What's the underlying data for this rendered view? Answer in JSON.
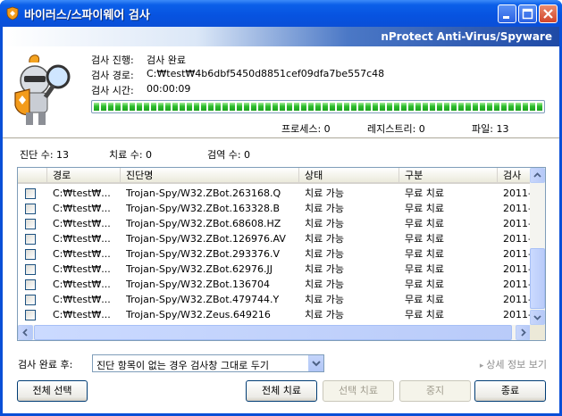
{
  "window": {
    "title": "바이러스/스파이웨어 검사",
    "brand": "nProtect Anti-Virus/Spyware"
  },
  "scan_info": {
    "progress_label": "검사 진행:",
    "progress_value": "검사 완료",
    "path_label": "검사 경로:",
    "path_value": "C:₩test₩4b6dbf5450d8851cef09dfa7be557c48",
    "time_label": "검사 시간:",
    "time_value": "00:00:09",
    "progress_fraction": 1.0
  },
  "counts": {
    "process": "프로세스: 0",
    "registry": "레지스트리: 0",
    "file": "파일: 13"
  },
  "summary": {
    "diagnosed": "진단 수: 13",
    "treated": "치료 수: 0",
    "quarantined": "검역 수: 0"
  },
  "table": {
    "columns": [
      "경로",
      "진단명",
      "상태",
      "구분",
      "검사"
    ],
    "rows": [
      {
        "path": "C:₩test₩...",
        "name": "Trojan-Spy/W32.ZBot.263168.Q",
        "status": "치료 가능",
        "type": "무료 치료",
        "date": "2011-"
      },
      {
        "path": "C:₩test₩...",
        "name": "Trojan-Spy/W32.ZBot.163328.B",
        "status": "치료 가능",
        "type": "무료 치료",
        "date": "2011-"
      },
      {
        "path": "C:₩test₩...",
        "name": "Trojan-Spy/W32.ZBot.68608.HZ",
        "status": "치료 가능",
        "type": "무료 치료",
        "date": "2011-"
      },
      {
        "path": "C:₩test₩...",
        "name": "Trojan-Spy/W32.ZBot.126976.AV",
        "status": "치료 가능",
        "type": "무료 치료",
        "date": "2011-"
      },
      {
        "path": "C:₩test₩...",
        "name": "Trojan-Spy/W32.ZBot.293376.V",
        "status": "치료 가능",
        "type": "무료 치료",
        "date": "2011-"
      },
      {
        "path": "C:₩test₩...",
        "name": "Trojan-Spy/W32.ZBot.62976.JJ",
        "status": "치료 가능",
        "type": "무료 치료",
        "date": "2011-"
      },
      {
        "path": "C:₩test₩...",
        "name": "Trojan-Spy/W32.ZBot.136704",
        "status": "치료 가능",
        "type": "무료 치료",
        "date": "2011-"
      },
      {
        "path": "C:₩test₩...",
        "name": "Trojan-Spy/W32.ZBot.479744.Y",
        "status": "치료 가능",
        "type": "무료 치료",
        "date": "2011-"
      },
      {
        "path": "C:₩test₩...",
        "name": "Trojan-Spy/W32.Zeus.649216",
        "status": "치료 가능",
        "type": "무료 치료",
        "date": "2011-"
      }
    ]
  },
  "after_scan": {
    "label": "검사 완료 후:",
    "selected": "진단 항목이 없는 경우 검사창 그대로 두기",
    "details_link": "상세 정보 보기"
  },
  "buttons": {
    "select_all": "전체 선택",
    "treat_all": "전체 치료",
    "treat_selected": "선택 치료",
    "stop": "중지",
    "exit": "종료"
  },
  "colors": {
    "title_bar": "#0753e0",
    "progress": "#2ebd2e",
    "brand_bar_end": "#1f4aa6"
  },
  "icons": [
    "shield-icon",
    "minimize-icon",
    "maximize-icon",
    "close-icon",
    "knight-mascot-icon",
    "chevron-down-icon"
  ]
}
